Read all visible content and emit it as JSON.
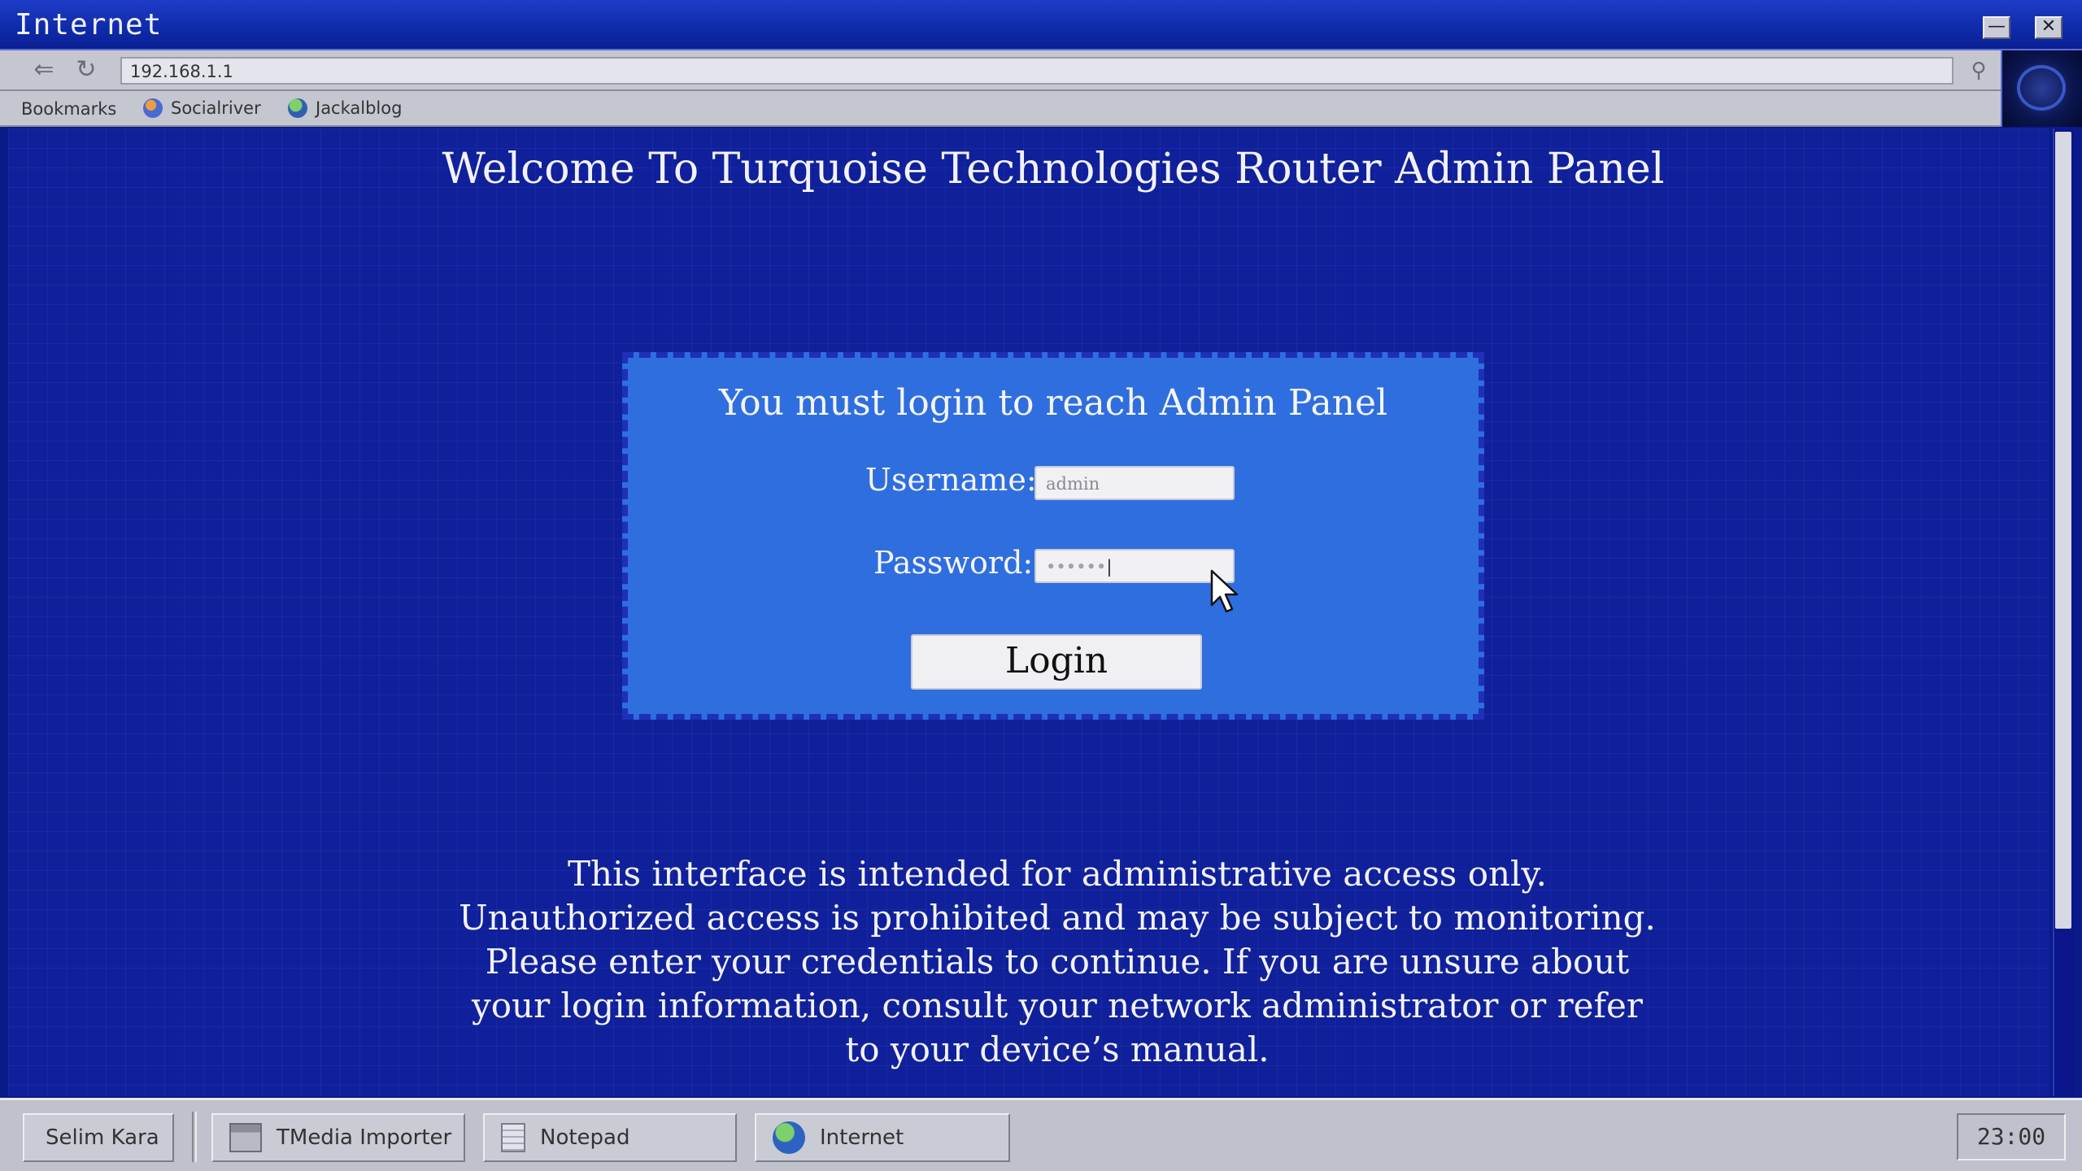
{
  "window": {
    "title": "Internet",
    "minimize_glyph": "—",
    "close_glyph": "✕"
  },
  "navbar": {
    "back_icon": "back-arrow-icon",
    "refresh_icon": "refresh-icon",
    "address": "192.168.1.1",
    "search_icon": "search-icon"
  },
  "bookmarks": {
    "label": "Bookmarks",
    "items": [
      {
        "label": "Socialriver",
        "icon": "people-icon"
      },
      {
        "label": "Jackalblog",
        "icon": "globe-icon"
      }
    ]
  },
  "page": {
    "heading": "Welcome To Turquoise Technologies Router Admin Panel",
    "panel_title": "You must login to reach Admin Panel",
    "username_label": "Username:",
    "username_value": "admin",
    "password_label": "Password:",
    "password_value": "••••••",
    "login_label": "Login",
    "notice_lines": [
      "This interface is intended for administrative access only.",
      "Unauthorized access is prohibited and may be subject to monitoring.",
      "Please enter your credentials to continue. If you are unsure about",
      "your login information, consult your network administrator or refer",
      "to your device’s manual."
    ]
  },
  "taskbar": {
    "user": "Selim Kara",
    "tasks": [
      {
        "label": "TMedia Importer",
        "icon": "media-importer-icon"
      },
      {
        "label": "Notepad",
        "icon": "notepad-icon"
      },
      {
        "label": "Internet",
        "icon": "globe-icon"
      }
    ],
    "clock": "23:00"
  },
  "colors": {
    "page_bg": "#10209a",
    "panel_bg": "#2f6ede",
    "panel_border": "#1e2fb8",
    "taskbar_bg": "#bfc1cc"
  }
}
